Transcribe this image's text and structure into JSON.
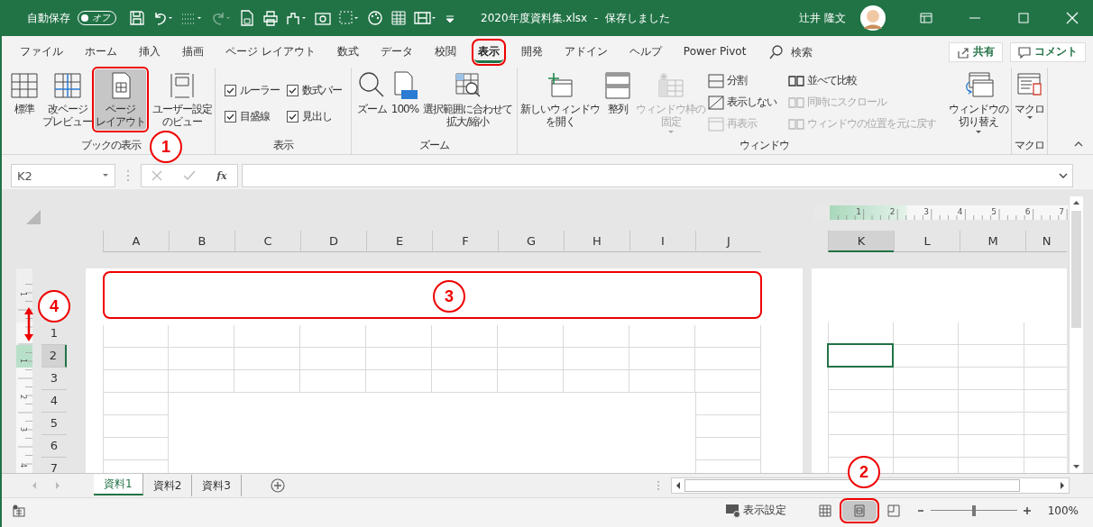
{
  "title_bar": {
    "autosave_label": "自動保存",
    "autosave": {
      "label": "オフ",
      "on": false
    },
    "document": "2020年度資料集.xlsx  -  保存しました",
    "user": "辻井 隆文"
  },
  "tabs": [
    {
      "label": "ファイル",
      "selected": false
    },
    {
      "label": "ホーム",
      "selected": false
    },
    {
      "label": "挿入",
      "selected": false
    },
    {
      "label": "描画",
      "selected": false
    },
    {
      "label": "ページ レイアウト",
      "selected": false
    },
    {
      "label": "数式",
      "selected": false
    },
    {
      "label": "データ",
      "selected": false
    },
    {
      "label": "校閲",
      "selected": false
    },
    {
      "label": "表示",
      "selected": true
    },
    {
      "label": "開発",
      "selected": false
    },
    {
      "label": "アドイン",
      "selected": false
    },
    {
      "label": "ヘルプ",
      "selected": false
    },
    {
      "label": "Power Pivot",
      "selected": false
    }
  ],
  "search": {
    "placeholder": "検索"
  },
  "share": "共有",
  "comment": "コメント",
  "ribbon": {
    "book_views": {
      "label": "ブックの表示",
      "buttons": [
        {
          "lines": [
            "標準"
          ],
          "selected": false
        },
        {
          "lines": [
            "改ページ",
            "プレビュー"
          ],
          "selected": false
        },
        {
          "lines": [
            "ページ",
            "レイアウト"
          ],
          "selected": true
        },
        {
          "lines": [
            "ユーザー設定",
            "のビュー"
          ],
          "selected": false
        }
      ]
    },
    "show": {
      "label": "表示",
      "checkboxes": [
        {
          "label": "ルーラー",
          "checked": true
        },
        {
          "label": "数式バー",
          "checked": true
        },
        {
          "label": "目盛線",
          "checked": true
        },
        {
          "label": "見出し",
          "checked": true
        }
      ]
    },
    "zoom": {
      "label": "ズーム",
      "buttons": [
        [
          "ズーム"
        ],
        [
          "100%"
        ],
        [
          "選択範囲に合わせて",
          "拡大/縮小"
        ]
      ]
    },
    "window": {
      "label": "ウィンドウ",
      "large": [
        {
          "lines": [
            "新しいウィンドウ",
            "を開く"
          ],
          "disabled": false
        },
        {
          "lines": [
            "整列"
          ],
          "disabled": false
        },
        {
          "lines": [
            "ウィンドウ枠の",
            "固定"
          ],
          "disabled": true
        }
      ],
      "small": [
        {
          "label": "分割",
          "disabled": false
        },
        {
          "label": "表示しない",
          "disabled": false
        },
        {
          "label": "再表示",
          "disabled": true
        },
        {
          "label": "並べて比較",
          "disabled": false
        },
        {
          "label": "同時にスクロール",
          "disabled": true
        },
        {
          "label": "ウィンドウの位置を元に戻す",
          "disabled": true
        }
      ],
      "switch": [
        "ウィンドウの",
        "切り替え"
      ]
    },
    "macro": {
      "label": "マクロ",
      "button": "マクロ"
    }
  },
  "formula_bar": {
    "name_box": "K2",
    "function_label": "fx"
  },
  "sheet": {
    "top_ruler": [
      "1",
      "2",
      "3",
      "4",
      "5",
      "6",
      "7"
    ],
    "left_ruler": [
      "1",
      "1",
      "2",
      "3",
      "4"
    ],
    "left_columns": [
      {
        "label": "A",
        "selected": false
      },
      {
        "label": "B",
        "selected": false
      },
      {
        "label": "C",
        "selected": false
      },
      {
        "label": "D",
        "selected": false
      },
      {
        "label": "E",
        "selected": false
      },
      {
        "label": "F",
        "selected": false
      },
      {
        "label": "G",
        "selected": false
      },
      {
        "label": "H",
        "selected": false
      },
      {
        "label": "I",
        "selected": false
      },
      {
        "label": "J",
        "selected": false
      }
    ],
    "right_columns": [
      {
        "label": "K",
        "selected": true
      },
      {
        "label": "L",
        "selected": false
      },
      {
        "label": "M",
        "selected": false
      },
      {
        "label": "N",
        "selected": false
      }
    ],
    "rows": [
      {
        "label": "1",
        "selected": false
      },
      {
        "label": "2",
        "selected": true
      },
      {
        "label": "3",
        "selected": false
      },
      {
        "label": "4",
        "selected": false
      },
      {
        "label": "5",
        "selected": false
      },
      {
        "label": "6",
        "selected": false
      },
      {
        "label": "7",
        "selected": false
      }
    ]
  },
  "sheet_tabs": [
    {
      "label": "資料1",
      "selected": true
    },
    {
      "label": "資料2",
      "selected": false
    },
    {
      "label": "資料3",
      "selected": false
    }
  ],
  "status_bar": {
    "display_settings": "表示設定",
    "views": [
      {
        "selected": false
      },
      {
        "selected": true
      },
      {
        "selected": false
      }
    ],
    "zoom": {
      "level": 0.5,
      "reading": "100%"
    }
  },
  "annotations": [
    {
      "number": "1"
    },
    {
      "number": "2"
    },
    {
      "number": "3"
    },
    {
      "number": "4"
    }
  ]
}
